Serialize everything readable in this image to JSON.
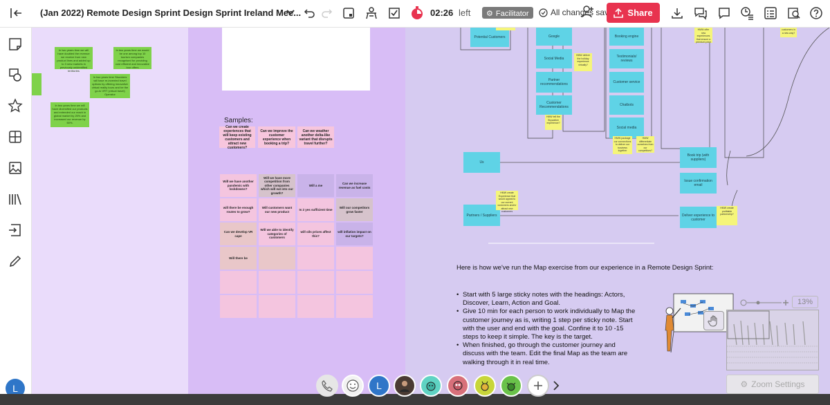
{
  "header": {
    "title": "(Jan 2022) Remote Design Sprint Design Sprint Ireland Mee...",
    "timer_value": "02:26",
    "timer_suffix": "left",
    "facilitator_label": "Facilitator",
    "saved_label": "All changes saved",
    "share_label": "Share"
  },
  "user": {
    "initial": "L"
  },
  "colors": {
    "share": "#e8334f",
    "purple_zone": "#d8bdf6",
    "map_zone": "#d6cbf1",
    "cyan_sticky": "#5fd3e6",
    "yellow_sticky": "#f5f57a"
  },
  "board": {
    "green_notes": [
      "In two years time we will have doubled the revenue we receive from new product lines and added up to 3 new markets in previously unidentified territories",
      "In two years time we would be one among top 10 tourism companies recognised for providing cost efficient and innovative tour offers",
      "In two years time Skwokers will have re-invented travel options by offering innovative virtual reality tours and be the go-to VRT (virtual travel) Operator",
      "In two years time we will have diversified our products and extended our reach in global market by 25% and increased our revenue by 50%."
    ],
    "samples_label": "Samples:",
    "samples": [
      "Can we create experiences that will keep existing customers and attract new customers?",
      "Can we improve the customer experience when booking a trip?",
      "Can we weather another delta-like variant that disrupts travel further?"
    ],
    "grid": [
      [
        "Will we have another pandemic with lockdowns?",
        "Will we have more competition from other companies which will eat into our growth?",
        "Will a me",
        "Can we increase revenue as fuel costs"
      ],
      [
        "will there be enough routes to grow?",
        "Will customers want our new product",
        "Is 2 yes sufficient time",
        "Will our competitors grow faster"
      ],
      [
        "Can we develop VR cape",
        "Will we able to identify categories of customers",
        "will oils prices affect this?",
        "will inflation impact on our targets?"
      ],
      [
        "Will there be",
        "",
        "",
        ""
      ],
      [
        "",
        "",
        "",
        ""
      ],
      [
        "",
        "",
        "",
        ""
      ]
    ],
    "map": {
      "cyan_notes": {
        "potential_customers": "Potential Customers",
        "google": "Google",
        "social_media": "Social Media",
        "partner_recs": "Partner recommendations",
        "customer_recs": "Customer Recommendations",
        "booking_engine": "Booking engine",
        "testimonials": "Testimonials/ reviews",
        "customer_service": "Customer service",
        "chatbots": "Chatbots",
        "social_media_2": "Social media",
        "us": "Us",
        "partners": "Partners / Suppliers",
        "book_trip": "Book trip (with suppliers)",
        "issue_conf": "Issue confirmation email",
        "deliver": "Deliver experience to customer"
      },
      "yellow_notes": {
        "hmw_deliver_holiday": "HMW deliver the holiday experience virtually?",
        "hmw_tell_skywalker": "HMW tell the Skywalker experience?",
        "hmw_package": "HMW package our connections to deliver our business together",
        "hmw_differentiate": "HMW differentiate ourselves from our competitors?",
        "hmw_create_partnership": "HMW create profitable partnership?",
        "hmw_create_experience": "HMW create Experience that would appeal to our current customers and/or attract new customers",
        "hmw_offer": "HMW offer new experiences that ensure a premium price",
        "customers_new_way": "customers in a new way?"
      }
    },
    "map_intro": "Here is how we've run the Map exercise from our experience in a Remote Design Sprint:",
    "bullets": [
      "Start with 5 large sticky notes with the headings: Actors, Discover, Learn, Action and Goal.",
      "Give 10 min for each person to work individually to Map the customer journey as is, writing 1 step per sticky note. Start with the user and end with the goal. Confine it to 10 -15 steps to keep it simple. The key is the target.",
      "When finished, go through the customer journey and discuss with the team. Edit the final Map as the team are walking through it in real time."
    ]
  },
  "zoom": {
    "percent": "13%",
    "settings_label": "Zoom Settings"
  },
  "dock": {
    "user_initial": "L"
  }
}
